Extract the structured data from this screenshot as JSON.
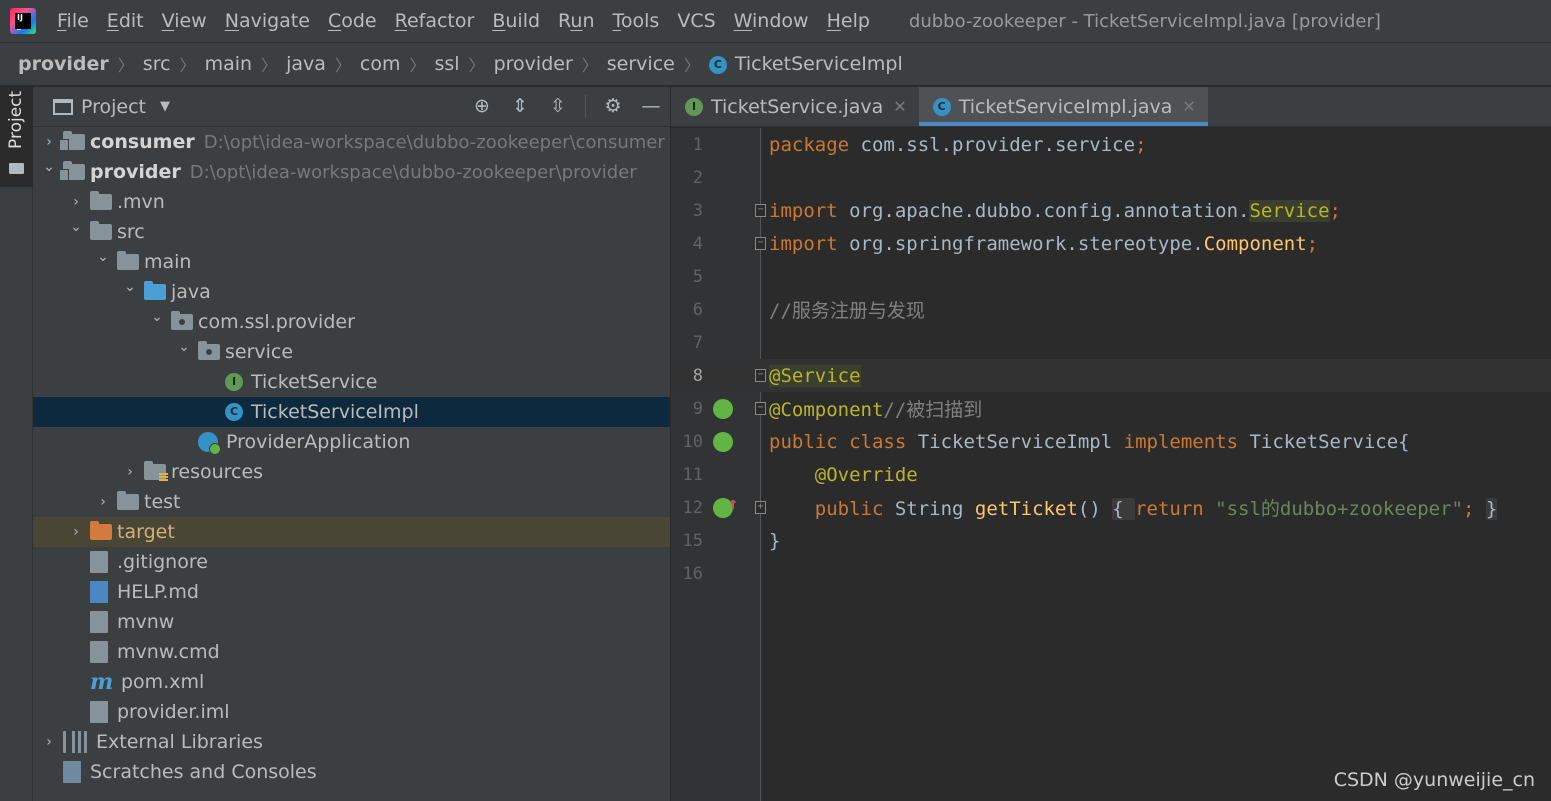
{
  "window": {
    "title": "dubbo-zookeeper - TicketServiceImpl.java [provider]"
  },
  "menu": [
    {
      "label": "File",
      "mnemonic_index": 0
    },
    {
      "label": "Edit",
      "mnemonic_index": 0
    },
    {
      "label": "View",
      "mnemonic_index": 0
    },
    {
      "label": "Navigate",
      "mnemonic_index": 0
    },
    {
      "label": "Code",
      "mnemonic_index": 0
    },
    {
      "label": "Refactor",
      "mnemonic_index": 0
    },
    {
      "label": "Build",
      "mnemonic_index": 0
    },
    {
      "label": "Run",
      "mnemonic_index": 1
    },
    {
      "label": "Tools",
      "mnemonic_index": 0
    },
    {
      "label": "VCS",
      "mnemonic_index": -1
    },
    {
      "label": "Window",
      "mnemonic_index": 0
    },
    {
      "label": "Help",
      "mnemonic_index": 0
    }
  ],
  "breadcrumb": [
    "provider",
    "src",
    "main",
    "java",
    "com",
    "ssl",
    "provider",
    "service",
    "TicketServiceImpl"
  ],
  "sidebar": {
    "stripe_label": "Project",
    "panel_title": "Project"
  },
  "tree": [
    {
      "depth": 0,
      "arrow": "right",
      "icon": "module-folder",
      "label": "consumer",
      "bold": true,
      "path": "D:\\opt\\idea-workspace\\dubbo-zookeeper\\consumer"
    },
    {
      "depth": 0,
      "arrow": "down",
      "icon": "module-folder",
      "label": "provider",
      "bold": true,
      "path": "D:\\opt\\idea-workspace\\dubbo-zookeeper\\provider"
    },
    {
      "depth": 1,
      "arrow": "right",
      "icon": "folder",
      "label": ".mvn"
    },
    {
      "depth": 1,
      "arrow": "down",
      "icon": "folder",
      "label": "src"
    },
    {
      "depth": 2,
      "arrow": "down",
      "icon": "folder",
      "label": "main"
    },
    {
      "depth": 3,
      "arrow": "down",
      "icon": "source-folder",
      "label": "java"
    },
    {
      "depth": 4,
      "arrow": "down",
      "icon": "package",
      "label": "com.ssl.provider"
    },
    {
      "depth": 5,
      "arrow": "down",
      "icon": "package",
      "label": "service"
    },
    {
      "depth": 6,
      "arrow": "none",
      "icon": "interface",
      "label": "TicketService"
    },
    {
      "depth": 6,
      "arrow": "none",
      "icon": "class",
      "label": "TicketServiceImpl",
      "selected": true
    },
    {
      "depth": 5,
      "arrow": "none",
      "icon": "spring-app",
      "label": "ProviderApplication"
    },
    {
      "depth": 3,
      "arrow": "right",
      "icon": "resources-folder",
      "label": "resources"
    },
    {
      "depth": 2,
      "arrow": "right",
      "icon": "folder",
      "label": "test"
    },
    {
      "depth": 1,
      "arrow": "right",
      "icon": "excluded-folder",
      "label": "target",
      "excluded": true
    },
    {
      "depth": 1,
      "arrow": "none",
      "icon": "ignore-file",
      "label": ".gitignore"
    },
    {
      "depth": 1,
      "arrow": "none",
      "icon": "md-file",
      "label": "HELP.md"
    },
    {
      "depth": 1,
      "arrow": "none",
      "icon": "shell-file",
      "label": "mvnw"
    },
    {
      "depth": 1,
      "arrow": "none",
      "icon": "text-file",
      "label": "mvnw.cmd"
    },
    {
      "depth": 1,
      "arrow": "none",
      "icon": "maven-file",
      "label": "pom.xml"
    },
    {
      "depth": 1,
      "arrow": "none",
      "icon": "iml-file",
      "label": "provider.iml"
    },
    {
      "depth": 0,
      "arrow": "right",
      "icon": "libraries",
      "label": "External Libraries"
    },
    {
      "depth": 0,
      "arrow": "none",
      "icon": "scratches",
      "label": "Scratches and Consoles"
    }
  ],
  "tabs": [
    {
      "label": "TicketService.java",
      "icon": "interface",
      "active": false
    },
    {
      "label": "TicketServiceImpl.java",
      "icon": "class",
      "active": true
    }
  ],
  "code": [
    {
      "n": "1",
      "tokens": [
        [
          "kw",
          "package "
        ],
        [
          "pl",
          "com.ssl.provider.service"
        ],
        [
          "kw",
          ";"
        ]
      ]
    },
    {
      "n": "2",
      "tokens": []
    },
    {
      "n": "3",
      "fold": "open",
      "tokens": [
        [
          "kw",
          "import "
        ],
        [
          "pl",
          "org.apache.dubbo.config.annotation."
        ],
        [
          "ann-hl",
          "Service"
        ],
        [
          "kw",
          ";"
        ]
      ]
    },
    {
      "n": "4",
      "fold": "close",
      "tokens": [
        [
          "kw",
          "import "
        ],
        [
          "pl",
          "org.springframework.stereotype."
        ],
        [
          "fn",
          "Component"
        ],
        [
          "kw",
          ";"
        ]
      ]
    },
    {
      "n": "5",
      "tokens": []
    },
    {
      "n": "6",
      "tokens": [
        [
          "cm",
          "//服务注册与发现"
        ]
      ]
    },
    {
      "n": "7",
      "tokens": []
    },
    {
      "n": "8",
      "fold": "open",
      "current": true,
      "tokens": [
        [
          "ann-hl",
          "@Service"
        ]
      ]
    },
    {
      "n": "9",
      "fold": "open",
      "gutter": "bean",
      "tokens": [
        [
          "ann",
          "@Component"
        ],
        [
          "cm",
          "//被扫描到"
        ]
      ]
    },
    {
      "n": "10",
      "gutter": "bean",
      "tokens": [
        [
          "kw",
          "public class "
        ],
        [
          "pl",
          "TicketServiceImpl "
        ],
        [
          "kw",
          "implements "
        ],
        [
          "pl",
          "TicketService{"
        ]
      ]
    },
    {
      "n": "11",
      "tokens": [
        [
          "pl",
          "    "
        ],
        [
          "ann",
          "@Override"
        ]
      ]
    },
    {
      "n": "12",
      "fold": "plus",
      "gutter": "impl",
      "tokens": [
        [
          "pl",
          "    "
        ],
        [
          "kw",
          "public "
        ],
        [
          "pl",
          "String "
        ],
        [
          "fn",
          "getTicket"
        ],
        [
          "pl",
          "() "
        ],
        [
          "fold-pl",
          "{ "
        ],
        [
          "kw",
          "return "
        ],
        [
          "str",
          "\"ssl的dubbo+zookeeper\""
        ],
        [
          "kw",
          ";"
        ],
        [
          "pl",
          " "
        ],
        [
          "fold-pl",
          "}"
        ]
      ]
    },
    {
      "n": "15",
      "tokens": [
        [
          "pl",
          "}"
        ]
      ]
    },
    {
      "n": "16",
      "tokens": []
    }
  ],
  "watermark": "CSDN @yunweijie_cn"
}
